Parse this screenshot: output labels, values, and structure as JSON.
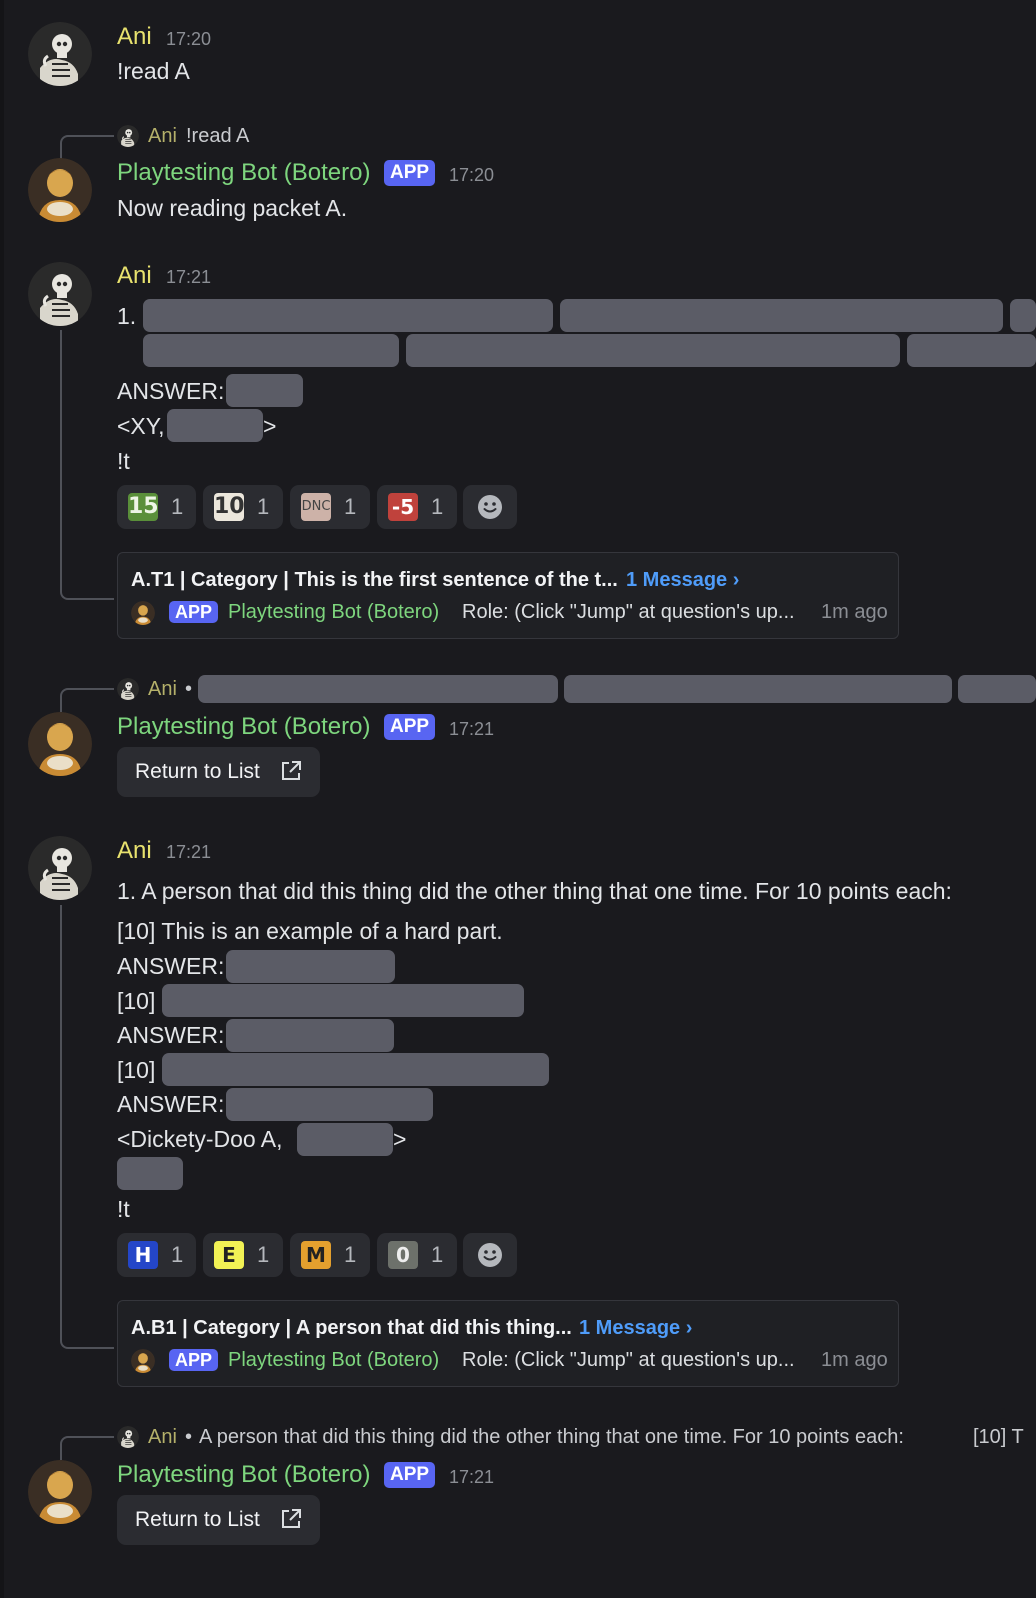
{
  "colors": {
    "background": "#1a1a1e",
    "ani_name": "#e8e26e",
    "bot_name": "#7ed67e",
    "app_badge": "#5865f2",
    "link": "#4f9cf9",
    "spoiler": "#5b5c66"
  },
  "messages": [
    {
      "author": "Ani",
      "time": "17:20",
      "text": "!read A"
    },
    {
      "reply": {
        "name": "Ani",
        "text": "!read A"
      },
      "author": "Playtesting Bot (Botero)",
      "badge": "APP",
      "time": "17:20",
      "text": "Now reading packet A."
    },
    {
      "author": "Ani",
      "time": "17:21",
      "lines": {
        "number": "1.",
        "answer": "ANSWER:",
        "tag_open": "<XY,",
        "tag_close": ">",
        "cmd": "!t"
      },
      "reactions": [
        {
          "icon": "15",
          "count": "1"
        },
        {
          "icon": "10",
          "count": "1"
        },
        {
          "icon": "DNC",
          "count": "1"
        },
        {
          "icon": "-5",
          "count": "1"
        }
      ],
      "thread": {
        "title": "A.T1 | Category | This is the first sentence of the t...",
        "link": "1 Message ›",
        "badge": "APP",
        "name": "Playtesting Bot (Botero)",
        "preview": "Role: (Click \"Jump\" at question's up...",
        "ago": "1m ago"
      }
    },
    {
      "reply": {
        "name": "Ani",
        "separator": "•"
      },
      "author": "Playtesting Bot (Botero)",
      "badge": "APP",
      "time": "17:21",
      "button": "Return to List"
    },
    {
      "author": "Ani",
      "time": "17:21",
      "lines": {
        "leadin": "1. A person that did this thing did the other thing that one time. For 10 points each:",
        "part1": "[10] This is an example of a hard part.",
        "answer1": "ANSWER:",
        "part2": "[10]",
        "answer2": "ANSWER:",
        "part3": "[10]",
        "answer3": "ANSWER:",
        "tag_open": "<Dickety-Doo A,",
        "tag_close": ">",
        "cmd": "!t"
      },
      "reactions": [
        {
          "icon": "H",
          "count": "1"
        },
        {
          "icon": "E",
          "count": "1"
        },
        {
          "icon": "M",
          "count": "1"
        },
        {
          "icon": "0",
          "count": "1"
        }
      ],
      "thread": {
        "title": "A.B1 | Category | A person that did this thing...",
        "link": "1 Message ›",
        "badge": "APP",
        "name": "Playtesting Bot (Botero)",
        "preview": "Role: (Click \"Jump\" at question's up...",
        "ago": "1m ago"
      }
    },
    {
      "reply": {
        "name": "Ani",
        "separator": "•",
        "text": "A person that did this thing did the other thing that one time. For 10 points each:",
        "text2": "[10] T"
      },
      "author": "Playtesting Bot (Botero)",
      "badge": "APP",
      "time": "17:21",
      "button": "Return to List"
    }
  ]
}
